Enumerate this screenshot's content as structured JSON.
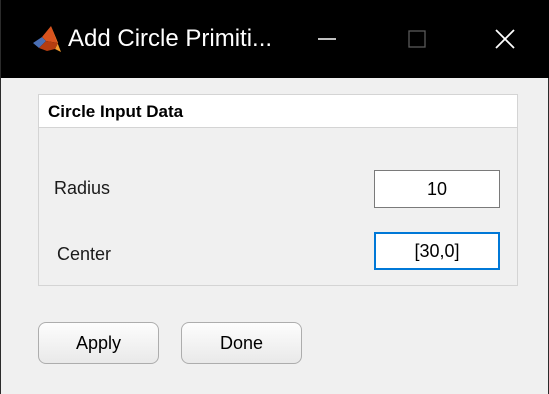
{
  "window": {
    "title": "Add Circle Primiti...",
    "app_icon": "matlab-membrane-icon",
    "controls": {
      "minimize_icon": "minimize-icon",
      "maximize_icon": "maximize-icon",
      "close_icon": "close-icon"
    }
  },
  "panel": {
    "title": "Circle Input Data",
    "fields": [
      {
        "label": "Radius",
        "value": "10"
      },
      {
        "label": "Center",
        "value": "[30,0]"
      }
    ]
  },
  "buttons": {
    "apply_label": "Apply",
    "done_label": "Done"
  },
  "colors": {
    "titlebar": "#000000",
    "focus_border": "#0078d7",
    "background": "#f0f0f0"
  }
}
